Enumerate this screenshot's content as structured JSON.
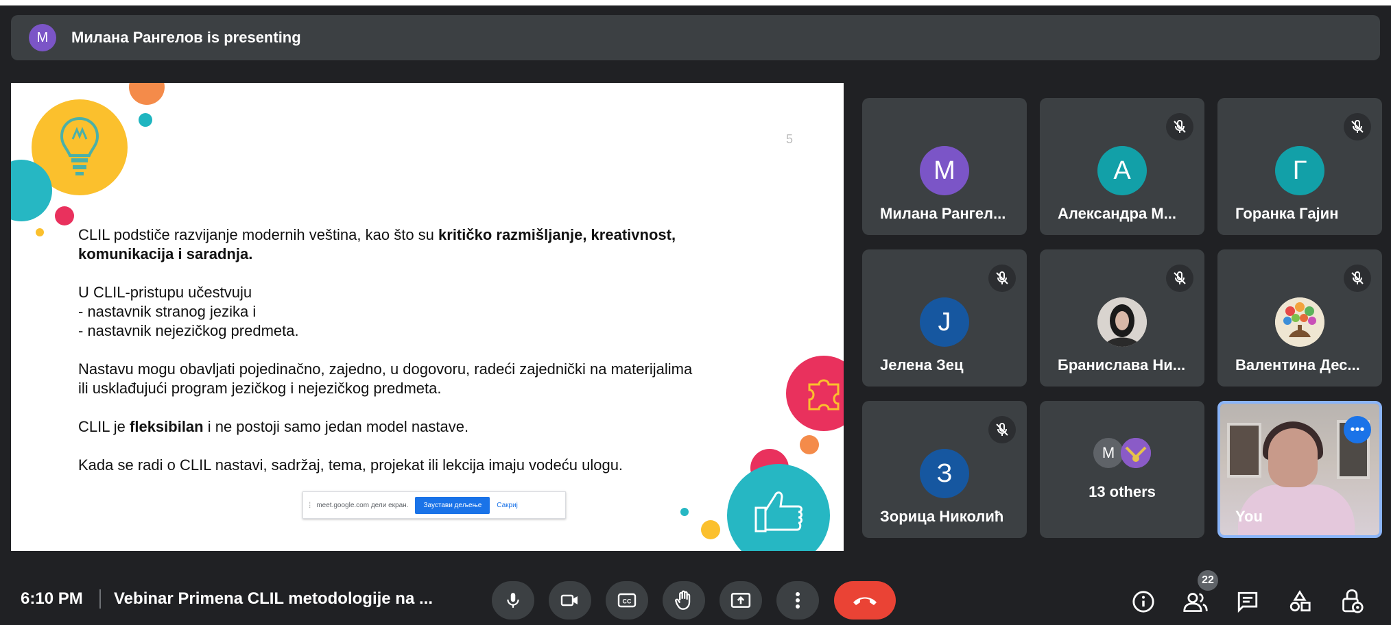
{
  "presenting": {
    "avatar_letter": "M",
    "text": "Милана Рангелов is presenting"
  },
  "slide": {
    "number": "5",
    "p1_text": "CLIL podstiče razvijanje modernih veština, kao što su ",
    "p1_bold": "kritičko razmišljanje, kreativnost, komunikacija i saradnja.",
    "p2_line1": "U CLIL-pristupu učestvuju",
    "p2_line2": "- nastavnik stranog jezika i",
    "p2_line3": "- nastavnik nejezičkog predmeta.",
    "p3_line1": "Nastavu mogu obavljati pojedinačno, zajedno, u dogovoru, radeći zajednički na materijalima",
    "p3_line2": "ili usklađujući program jezičkog i nejezičkog predmeta.",
    "p4_pre": "CLIL je ",
    "p4_bold": "fleksibilan",
    "p4_post": " i ne postoji samo jedan model nastave.",
    "p5": "Kada se radi o CLIL nastavi, sadržaj, tema, projekat ili lekcija imaju vodeću ulogu.",
    "share_bar": {
      "text": "meet.google.com дели екран.",
      "stop_label": "Заустави дељење",
      "hide_label": "Сакриј"
    }
  },
  "participants": [
    {
      "letter": "M",
      "name": "Милана Рангел...",
      "color": "#7b55c7",
      "muted": false
    },
    {
      "letter": "A",
      "name": "Александра М...",
      "color": "#12a0a8",
      "muted": true
    },
    {
      "letter": "Г",
      "name": "Горанка Гајин",
      "color": "#12a0a8",
      "muted": true
    },
    {
      "letter": "J",
      "name": "Јелена Зец",
      "color": "#1657a0",
      "muted": true
    },
    {
      "letter": "",
      "name": "Бранислава Ни...",
      "color": "#4a4a4a",
      "muted": true
    },
    {
      "letter": "",
      "name": "Валентина Дес...",
      "color": "#e0d0b0",
      "muted": true
    },
    {
      "letter": "З",
      "name": "Зорица Николић",
      "color": "#1657a0",
      "muted": true
    }
  ],
  "others": {
    "avatar_letter": "M",
    "label": "13 others"
  },
  "you": {
    "label": "You"
  },
  "bottom": {
    "time": "6:10 PM",
    "meeting_title": "Vebinar Primena CLIL metodologije na ...",
    "people_count": "22"
  },
  "colors": {
    "accent": "#1a73e8",
    "end_call": "#ea4335",
    "tile_bg": "#3c4043",
    "background": "#202124"
  },
  "icons": {
    "controls": [
      "microphone-icon",
      "camera-icon",
      "captions-icon",
      "raise-hand-icon",
      "present-screen-icon",
      "more-options-icon",
      "end-call-icon"
    ],
    "right": [
      "info-icon",
      "people-icon",
      "chat-icon",
      "activities-icon",
      "host-controls-icon"
    ]
  }
}
